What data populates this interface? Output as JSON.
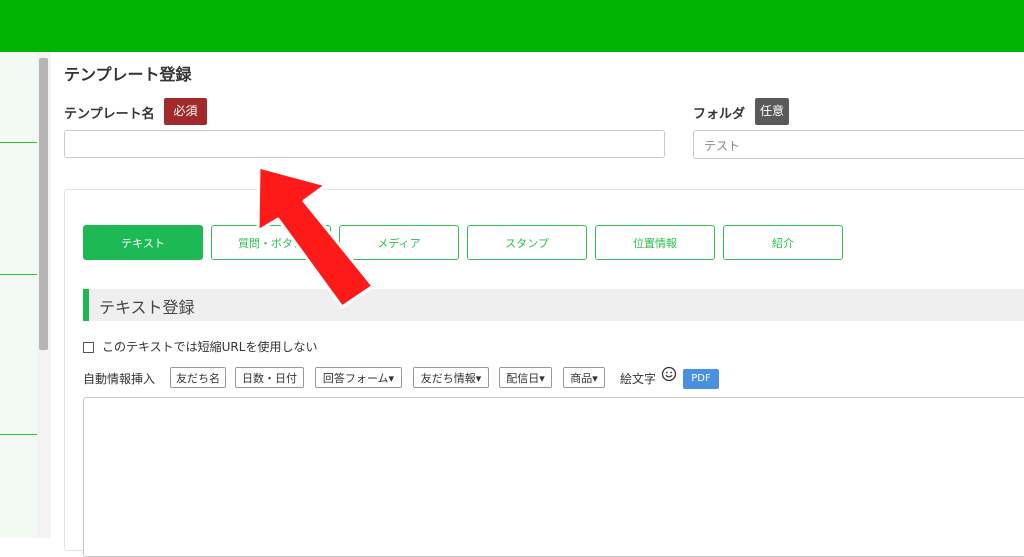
{
  "form": {
    "title": "テンプレート登録",
    "name_label": "テンプレート名",
    "required_badge": "必須",
    "name_value": "",
    "folder_label": "フォルダ",
    "optional_badge": "任意",
    "folder_value": "テスト"
  },
  "tabs": [
    {
      "label": "テキスト",
      "active": true
    },
    {
      "label": "質問・ボタン",
      "active": false
    },
    {
      "label": "メディア",
      "active": false
    },
    {
      "label": "スタンプ",
      "active": false
    },
    {
      "label": "位置情報",
      "active": false
    },
    {
      "label": "紹介",
      "active": false
    }
  ],
  "section": {
    "title": "テキスト登録"
  },
  "options": {
    "short_url_label": "このテキストでは短縮URLを使用しない",
    "short_url_checked": false
  },
  "insert_toolbar": {
    "label": "自動情報挿入",
    "buttons": [
      "友だち名",
      "日数・日付",
      "回答フォーム▾",
      "友だち情報▾",
      "配信日▾",
      "商品▾"
    ],
    "emoji_label": "絵文字",
    "emoji_icon": "smile-icon",
    "pdf_label": "PDF"
  },
  "message_text": "",
  "colors": {
    "header_green": "#00b300",
    "accent_green": "#1db954",
    "required_red": "#a32a2a",
    "optional_gray": "#5a5a5a",
    "pdf_blue": "#4a90e2",
    "annotation_arrow": "#ff1a1a"
  }
}
